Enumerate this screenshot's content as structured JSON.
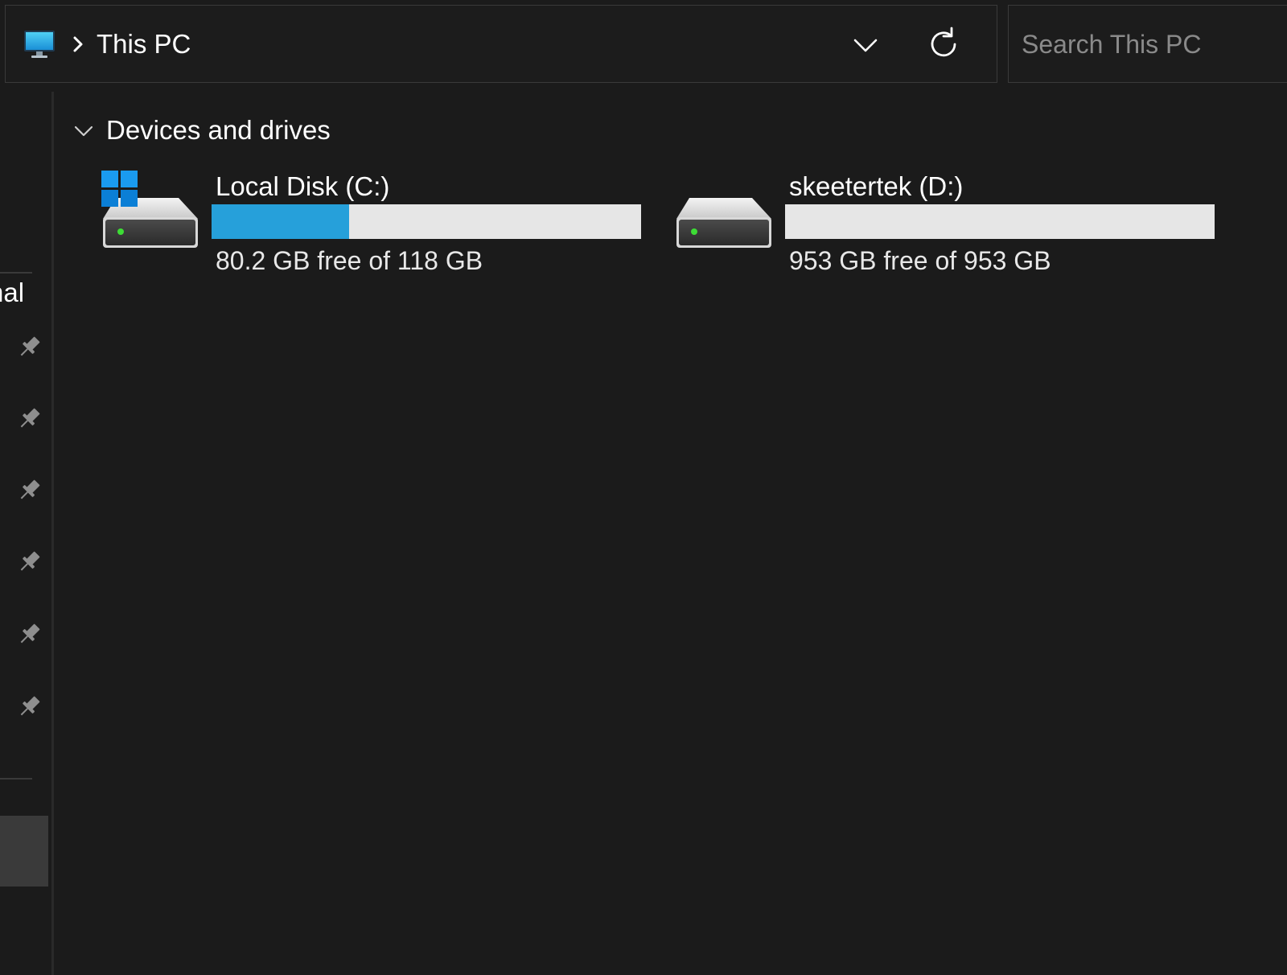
{
  "address_bar": {
    "location_icon": "this-pc-monitor-icon",
    "separator_icon": "chevron-right-icon",
    "location_label": "This PC",
    "dropdown_icon": "chevron-down-icon",
    "refresh_icon": "refresh-icon"
  },
  "search": {
    "placeholder": "Search This PC",
    "value": ""
  },
  "sidebar": {
    "partial_label": "nal",
    "pins": [
      {
        "icon": "pin-icon"
      },
      {
        "icon": "pin-icon"
      },
      {
        "icon": "pin-icon"
      },
      {
        "icon": "pin-icon"
      },
      {
        "icon": "pin-icon"
      },
      {
        "icon": "pin-icon"
      }
    ]
  },
  "main": {
    "section": {
      "title": "Devices and drives",
      "expanded": true,
      "chevron_icon": "chevron-down-icon"
    },
    "drives": [
      {
        "name": "Local Disk (C:)",
        "free_text": "80.2 GB free of 118 GB",
        "used_fraction": 0.32,
        "icon": "system-drive-icon",
        "has_windows_logo": true
      },
      {
        "name": "skeetertek (D:)",
        "free_text": "953 GB free of 953 GB",
        "used_fraction": 0.0,
        "icon": "hard-drive-icon",
        "has_windows_logo": false
      }
    ]
  },
  "colors": {
    "background": "#1b1b1b",
    "usage_fill": "#26a0da",
    "usage_track": "#e6e6e6",
    "text": "#ffffff",
    "placeholder": "#8a8a8a",
    "border": "#3a3a3a",
    "drive_led": "#3ddc35",
    "windows_logo": "#0f8fe3"
  }
}
